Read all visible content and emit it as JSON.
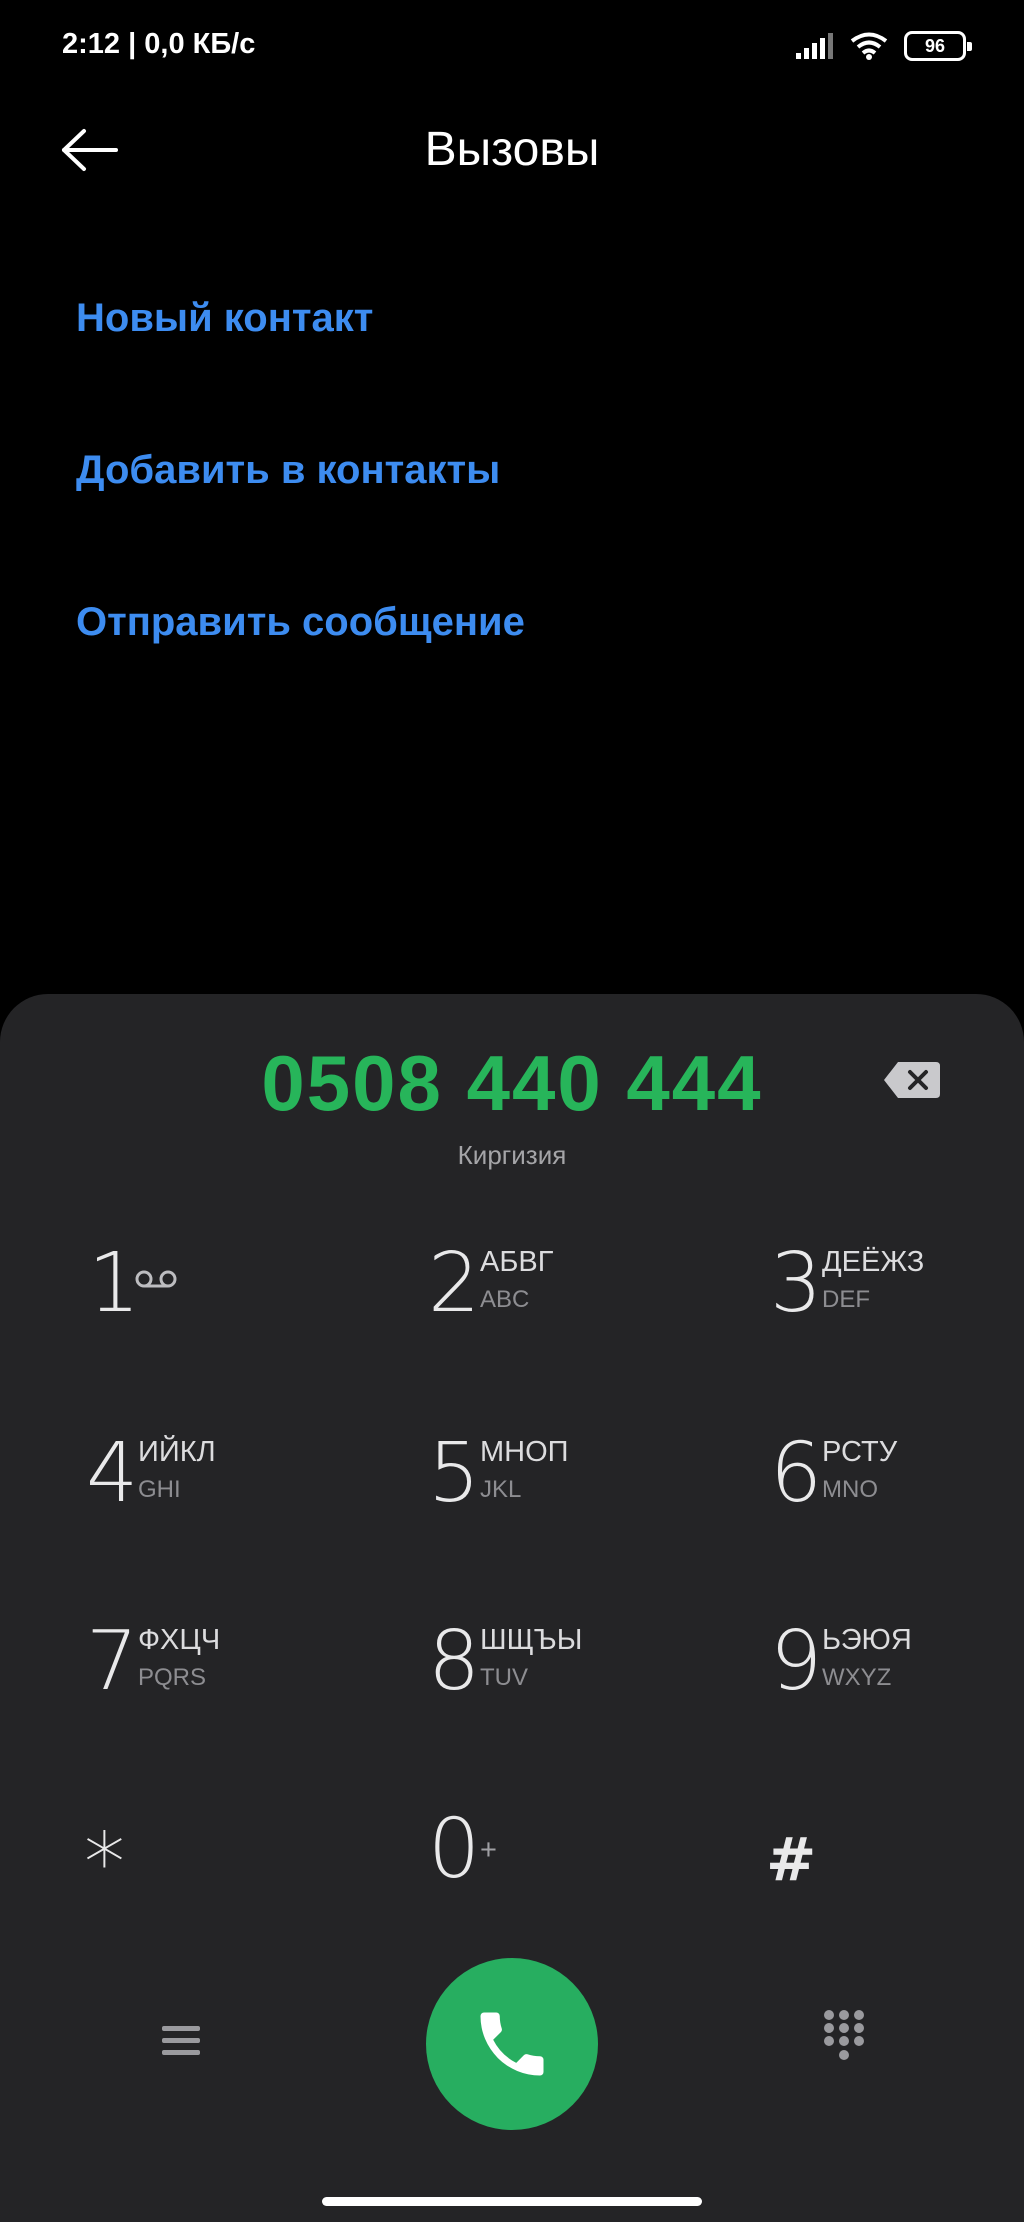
{
  "status_bar": {
    "time": "2:12 | 0,0 КБ/с",
    "battery": "96",
    "icons": [
      "signal-icon",
      "wifi-icon",
      "battery-icon"
    ]
  },
  "header": {
    "title": "Вызовы",
    "back_icon": "arrow-left-icon"
  },
  "options": {
    "new_contact": "Новый контакт",
    "add_to_contacts": "Добавить в контакты",
    "send_message": "Отправить сообщение"
  },
  "dialer": {
    "number": "0508 440 444",
    "region": "Киргизия",
    "backspace_icon": "backspace-icon",
    "keys": [
      {
        "digit": "1",
        "cyr": "",
        "lat": "",
        "extra": "voicemail-icon"
      },
      {
        "digit": "2",
        "cyr": "АБВГ",
        "lat": "ABC"
      },
      {
        "digit": "3",
        "cyr": "ДЕЁЖЗ",
        "lat": "DEF"
      },
      {
        "digit": "4",
        "cyr": "ИЙКЛ",
        "lat": "GHI"
      },
      {
        "digit": "5",
        "cyr": "МНОП",
        "lat": "JKL"
      },
      {
        "digit": "6",
        "cyr": "РСТУ",
        "lat": "MNO"
      },
      {
        "digit": "7",
        "cyr": "ФХЦЧ",
        "lat": "PQRS"
      },
      {
        "digit": "8",
        "cyr": "ШЩЪЫ",
        "lat": "TUV"
      },
      {
        "digit": "9",
        "cyr": "ЬЭЮЯ",
        "lat": "WXYZ"
      },
      {
        "digit": "*",
        "cyr": "",
        "lat": ""
      },
      {
        "digit": "0",
        "cyr": "+",
        "lat": ""
      },
      {
        "digit": "#",
        "cyr": "",
        "lat": ""
      }
    ],
    "bottom_icons": [
      "menu-icon",
      "phone-icon",
      "dialpad-icon"
    ]
  },
  "colors": {
    "accent_link": "#3d8cf0",
    "number_green": "#27b55a",
    "call_button": "#27ae60",
    "panel_bg": "#242426"
  }
}
